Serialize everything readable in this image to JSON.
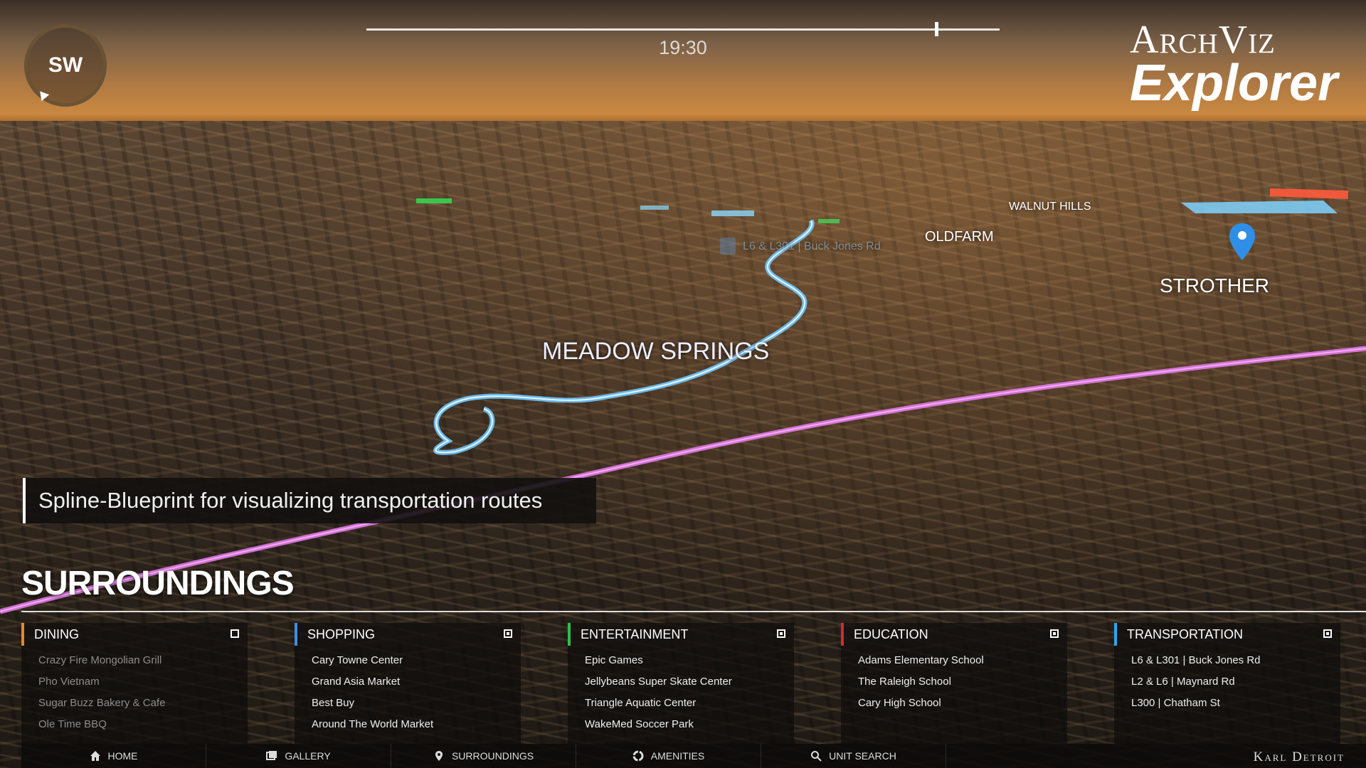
{
  "compass": {
    "direction": "SW"
  },
  "time": {
    "label": "19:30"
  },
  "logo": {
    "line1": "ArchViz",
    "line2": "Explorer"
  },
  "map_labels": {
    "meadow_springs": "MEADOW SPRINGS",
    "walnut_hills": "WALNUT HILLS",
    "oldfarm": "OLDFARM",
    "strother": "STROTHER",
    "station": "L6 & L301 | Buck Jones Rd"
  },
  "caption": "Spline-Blueprint for visualizing transportation routes",
  "section_title": "SURROUNDINGS",
  "categories": [
    {
      "title": "DINING",
      "color": "#e08a2a",
      "checked": false,
      "items": [
        "Crazy Fire Mongolian Grill",
        "Pho Vietnam",
        "Sugar Buzz Bakery & Cafe",
        "Ole Time BBQ"
      ]
    },
    {
      "title": "SHOPPING",
      "color": "#3c8ee6",
      "checked": true,
      "items": [
        "Cary Towne Center",
        "Grand Asia Market",
        "Best Buy",
        "Around The World Market"
      ]
    },
    {
      "title": "ENTERTAINMENT",
      "color": "#2fbf4a",
      "checked": true,
      "items": [
        "Epic Games",
        "Jellybeans Super Skate Center",
        "Triangle Aquatic Center",
        "WakeMed Soccer Park"
      ]
    },
    {
      "title": "EDUCATION",
      "color": "#d42a2a",
      "checked": true,
      "items": [
        "Adams Elementary School",
        "The Raleigh School",
        "Cary High School"
      ]
    },
    {
      "title": "TRANSPORTATION",
      "color": "#29a9e8",
      "checked": true,
      "items": [
        "L6 & L301 | Buck Jones Rd",
        "L2 & L6 | Maynard Rd",
        "L300 | Chatham St"
      ]
    }
  ],
  "nav": [
    {
      "label": "HOME",
      "icon": "home-icon"
    },
    {
      "label": "GALLERY",
      "icon": "gallery-icon"
    },
    {
      "label": "SURROUNDINGS",
      "icon": "location-pin-icon"
    },
    {
      "label": "AMENITIES",
      "icon": "amenities-icon"
    },
    {
      "label": "UNIT SEARCH",
      "icon": "search-icon"
    }
  ],
  "brand": "Karl Detroit"
}
